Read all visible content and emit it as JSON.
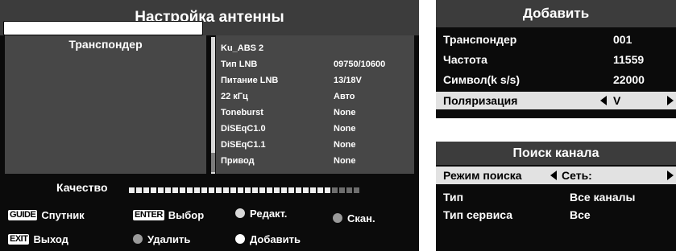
{
  "antenna": {
    "title": "Настройка антенны",
    "transponder_header": "Транспондер",
    "transponder_value": "",
    "info": [
      {
        "label": "Ku_ABS 2",
        "value": ""
      },
      {
        "label": "Тип LNB",
        "value": "09750/10600"
      },
      {
        "label": "Питание LNB",
        "value": "13/18V"
      },
      {
        "label": "22 кГц",
        "value": "Авто"
      },
      {
        "label": "Toneburst",
        "value": "None"
      },
      {
        "label": "DiSEqC1.0",
        "value": "None"
      },
      {
        "label": "DiSEqC1.1",
        "value": "None"
      },
      {
        "label": "Привод",
        "value": "None"
      }
    ],
    "quality": {
      "label": "Качество",
      "filled_segments": 28,
      "total_segments": 32
    }
  },
  "keys": {
    "guide": {
      "cap": "GUIDE",
      "label": "Спутник"
    },
    "enter": {
      "cap": "ENTER",
      "label": "Выбор"
    },
    "edit": {
      "label": "Редакт."
    },
    "scan": {
      "label": "Скан."
    },
    "exit": {
      "cap": "EXIT",
      "label": "Выход"
    },
    "delete": {
      "label": "Удалить"
    },
    "add": {
      "label": "Добавить"
    }
  },
  "add": {
    "title": "Добавить",
    "rows": [
      {
        "label": "Транспондер",
        "value": "001"
      },
      {
        "label": "Частота",
        "value": "11559"
      },
      {
        "label": "Символ(k s/s)",
        "value": "22000"
      }
    ],
    "polarization": {
      "label": "Поляризация",
      "value": "V"
    }
  },
  "search": {
    "title": "Поиск канала",
    "mode": {
      "label": "Режим поиска",
      "value": "Сеть:"
    },
    "type": {
      "label": "Тип",
      "value": "Все каналы"
    },
    "service": {
      "label": "Тип сервиса",
      "value": "Все"
    }
  },
  "colors": {
    "panel_bg": "#0b0b0b",
    "title_bg": "#3c3c3c",
    "box_bg": "#474747",
    "highlight": "#e2e2e2"
  }
}
